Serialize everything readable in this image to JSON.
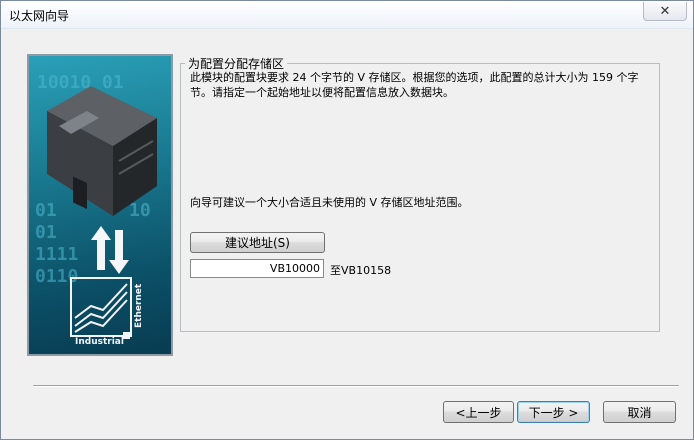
{
  "window": {
    "title": "以太网向导",
    "close_glyph": "✕"
  },
  "image": {
    "binary_row1": "10010 01",
    "binary_rows": [
      "01",
      "10",
      "01",
      "1111",
      "0110"
    ],
    "industrial_label": "Industrial",
    "ethernet_label": "Ethernet"
  },
  "group": {
    "legend": "为配置分配存储区",
    "description": "此模块的配置块要求 24 个字节的 V 存储区。根据您的选项，此配置的总计大小为 159 个字节。请指定一个起始地址以便将配置信息放入数据块。",
    "hint": "向导可建议一个大小合适且未使用的 V 存储区地址范围。",
    "suggest_button": "建议地址(S)",
    "start_address": "VB10000",
    "to_label": "至VB10158"
  },
  "footer": {
    "prev_button": "<上一步",
    "next_button": "下一步 >",
    "cancel_button": "取消"
  }
}
